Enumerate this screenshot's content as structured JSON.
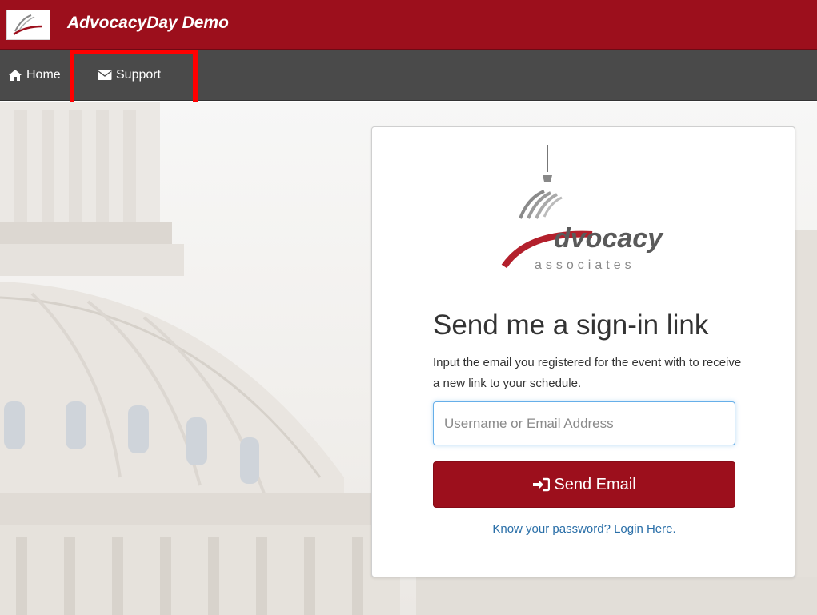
{
  "header": {
    "title": "AdvocacyDay Demo",
    "logo_text": "Advocacy"
  },
  "nav": {
    "home_label": "Home",
    "support_label": "Support",
    "home_icon": "home-icon",
    "support_icon": "envelope-icon"
  },
  "card": {
    "logo_text": "dvocacy",
    "logo_sub": "associates",
    "heading": "Send me a sign-in link",
    "description": "Input the email you registered for the event with to receive a new link to your schedule.",
    "email_placeholder": "Username or Email Address",
    "email_value": "",
    "send_button_label": "Send Email",
    "send_icon": "sign-in-icon",
    "login_link": "Know your password? Login Here."
  },
  "colors": {
    "brand": "#9c0f1c",
    "nav_bg": "#4a4a4a",
    "link": "#2a6fa8",
    "highlight": "#ff0000"
  }
}
